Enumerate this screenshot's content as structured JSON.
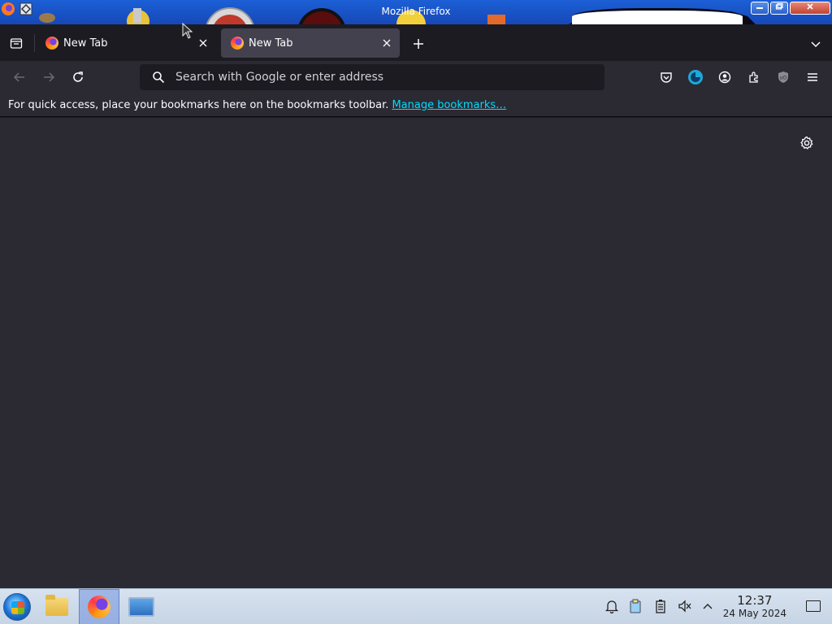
{
  "window": {
    "title": "Mozilla Firefox",
    "controls": {
      "minimize": "minimize",
      "maximize": "maximize",
      "close": "close"
    }
  },
  "tabs": [
    {
      "label": "New Tab",
      "active": false,
      "favicon": "firefox-icon"
    },
    {
      "label": "New Tab",
      "active": true,
      "favicon": "firefox-icon"
    }
  ],
  "navbar": {
    "search_placeholder": "Search with Google or enter address",
    "icons": [
      "back-icon",
      "forward-icon",
      "reload-icon",
      "search-icon",
      "pocket-icon",
      "avatar-icon",
      "account-icon",
      "extensions-icon",
      "ublock-icon",
      "menu-icon"
    ]
  },
  "bookmarks": {
    "hint": "For quick access, place your bookmarks here on the bookmarks toolbar.",
    "manage_link": "Manage bookmarks…"
  },
  "taskbar": {
    "items": [
      "start-button",
      "file-manager",
      "firefox",
      "system-monitor"
    ],
    "active_item": "firefox",
    "tray_icons": [
      "notification-bell-icon",
      "clipboard-icon",
      "battery-icon",
      "volume-muted-icon",
      "chevron-up-icon"
    ],
    "clock": {
      "time": "12:37",
      "date": "24 May 2024"
    }
  },
  "colors": {
    "tabstrip_bg": "#1c1b22",
    "active_tab_bg": "#42414d",
    "navbar_bg": "#2b2a33",
    "content_bg": "#2b2a33",
    "link": "#00ddff",
    "titlebar": "#1c5fd6"
  }
}
